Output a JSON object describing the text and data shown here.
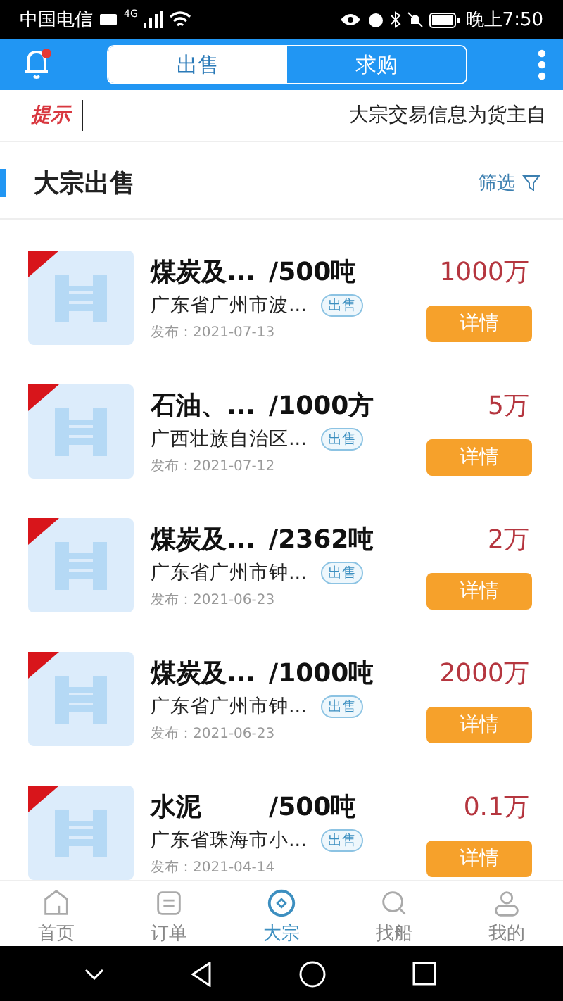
{
  "status_bar": {
    "carrier": "中国电信",
    "network": "4G",
    "time": "晚上7:50"
  },
  "header": {
    "notification_dot": true,
    "tabs": [
      {
        "label": "出售",
        "selected": true
      },
      {
        "label": "求购",
        "selected": false
      }
    ]
  },
  "notice": {
    "label": "提示",
    "text": "大宗交易信息为货主自"
  },
  "section": {
    "title": "大宗出售",
    "filter": "筛选"
  },
  "listings": [
    {
      "name": "煤炭及...",
      "quantity": "/500吨",
      "location": "广东省广州市波...",
      "tag": "出售",
      "date": "发布：2021-07-13",
      "price": "1000万",
      "action": "详情"
    },
    {
      "name": "石油、...",
      "quantity": "/1000方",
      "location": "广西壮族自治区...",
      "tag": "出售",
      "date": "发布：2021-07-12",
      "price": "5万",
      "action": "详情"
    },
    {
      "name": "煤炭及...",
      "quantity": "/2362吨",
      "location": "广东省广州市钟...",
      "tag": "出售",
      "date": "发布：2021-06-23",
      "price": "2万",
      "action": "详情"
    },
    {
      "name": "煤炭及...",
      "quantity": "/1000吨",
      "location": "广东省广州市钟...",
      "tag": "出售",
      "date": "发布：2021-06-23",
      "price": "2000万",
      "action": "详情"
    },
    {
      "name": "水泥",
      "quantity": "/500吨",
      "location": "广东省珠海市小...",
      "tag": "出售",
      "date": "发布：2021-04-14",
      "price": "0.1万",
      "action": "详情"
    }
  ],
  "bottom_nav": [
    {
      "label": "首页",
      "kind": "home",
      "selected": false
    },
    {
      "label": "订单",
      "kind": "order",
      "selected": false
    },
    {
      "label": "大宗",
      "kind": "bulk",
      "selected": true
    },
    {
      "label": "找船",
      "kind": "search",
      "selected": false
    },
    {
      "label": "我的",
      "kind": "profile",
      "selected": false
    }
  ]
}
